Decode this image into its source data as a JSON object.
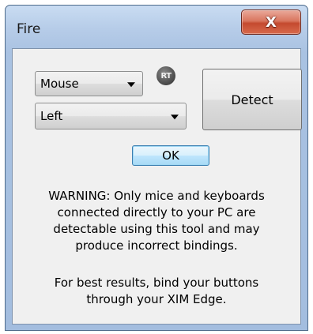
{
  "window": {
    "title": "Fire",
    "close_glyph": "X"
  },
  "controls": {
    "device_select": {
      "value": "Mouse"
    },
    "button_select": {
      "value": "Left"
    },
    "rt_badge": "RT",
    "detect_label": "Detect",
    "ok_label": "OK"
  },
  "messages": {
    "warning": "WARNING: Only mice and keyboards\nconnected directly to your PC are\ndetectable using this tool and may\nproduce incorrect bindings.",
    "tip": "For best results, bind your buttons\nthrough your XIM Edge."
  },
  "icons": {
    "close": "close-icon",
    "dropdown": "chevron-down-icon",
    "rt": "rt-badge-icon"
  }
}
